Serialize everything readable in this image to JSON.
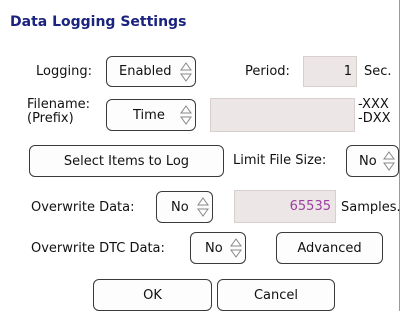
{
  "title": "Data Logging Settings",
  "logging": {
    "label": "Logging:",
    "value": "Enabled"
  },
  "period": {
    "label": "Period:",
    "value": "1",
    "unit": "Sec."
  },
  "filename": {
    "label_line1": "Filename:",
    "label_line2": "(Prefix)",
    "value": "Time",
    "text": "",
    "suffix1": "-XXX",
    "suffix2": "-DXX"
  },
  "select_items_button": "Select Items to Log",
  "limit_file_size": {
    "label": "Limit File Size:",
    "value": "No"
  },
  "overwrite_data": {
    "label": "Overwrite Data:",
    "value": "No"
  },
  "samples": {
    "value": "65535",
    "unit": "Samples.",
    "value_color": "#9c3fa0"
  },
  "overwrite_dtc": {
    "label": "Overwrite DTC Data:",
    "value": "No"
  },
  "advanced_button": "Advanced",
  "ok_button": "OK",
  "cancel_button": "Cancel"
}
